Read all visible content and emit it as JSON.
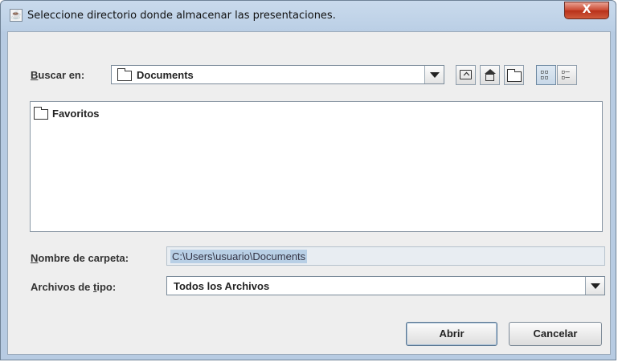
{
  "window": {
    "title": "Seleccione directorio donde almacenar las presentaciones.",
    "close_label": "X"
  },
  "lookin": {
    "label_accel": "B",
    "label_rest": "uscar en:",
    "value": "Documents"
  },
  "toolbar": {
    "icons": [
      "up-folder-icon",
      "home-icon",
      "new-folder-icon",
      "list-view-icon",
      "details-view-icon"
    ]
  },
  "files": [
    {
      "name": "Favoritos",
      "icon": "folder-icon"
    }
  ],
  "foldername": {
    "label_accel": "N",
    "label_rest": "ombre de carpeta:",
    "value": "C:\\Users\\usuario\\Documents"
  },
  "filetype": {
    "label_pre": "Archivos de ",
    "label_accel": "t",
    "label_post": "ipo:",
    "value": "Todos los Archivos"
  },
  "buttons": {
    "open": "Abrir",
    "cancel": "Cancelar"
  },
  "colors": {
    "title_bar": "#c9daec",
    "close_button": "#c9472f",
    "dialog_bg": "#eeeeee",
    "selection": "#b8cfe5"
  }
}
